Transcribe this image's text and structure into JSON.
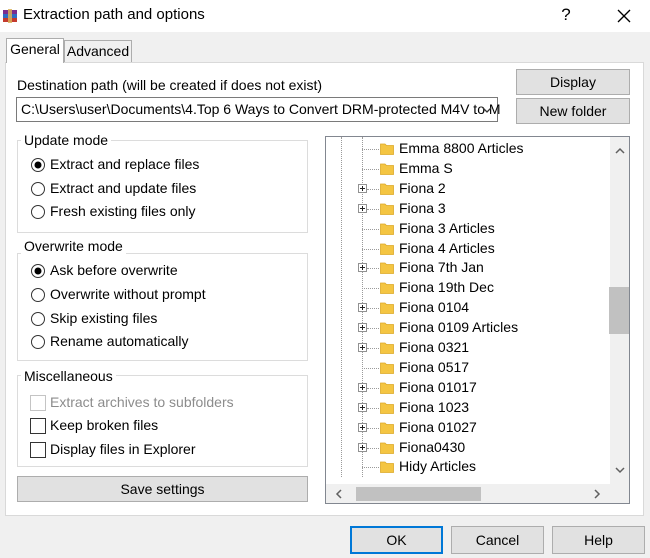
{
  "window": {
    "title": "Extraction path and options",
    "help_label": "?",
    "close_icon": "close-icon",
    "app_icon": "winrar-books-icon"
  },
  "tabs": [
    {
      "label": "General",
      "selected": true
    },
    {
      "label": "Advanced",
      "selected": false
    }
  ],
  "destination": {
    "label": "Destination path (will be created if does not exist)",
    "value": "C:\\Users\\user\\Documents\\4.Top 6 Ways to Convert DRM-protected M4V to M"
  },
  "buttons": {
    "display": "Display",
    "new_folder": "New folder",
    "save_settings": "Save settings",
    "ok": "OK",
    "cancel": "Cancel",
    "help": "Help"
  },
  "update_mode": {
    "label": "Update mode",
    "options": [
      {
        "label": "Extract and replace files",
        "checked": true
      },
      {
        "label": "Extract and update files",
        "checked": false
      },
      {
        "label": "Fresh existing files only",
        "checked": false
      }
    ]
  },
  "overwrite_mode": {
    "label": "Overwrite mode",
    "options": [
      {
        "label": "Ask before overwrite",
        "checked": true
      },
      {
        "label": "Overwrite without prompt",
        "checked": false
      },
      {
        "label": "Skip existing files",
        "checked": false
      },
      {
        "label": "Rename automatically",
        "checked": false
      }
    ]
  },
  "misc": {
    "label": "Miscellaneous",
    "options": [
      {
        "label": "Extract archives to subfolders",
        "checked": false,
        "disabled": true
      },
      {
        "label": "Keep broken files",
        "checked": false,
        "disabled": false
      },
      {
        "label": "Display files in Explorer",
        "checked": false,
        "disabled": false
      }
    ]
  },
  "tree": {
    "items": [
      {
        "label": "Emma 8800 Articles",
        "expandable": false
      },
      {
        "label": "Emma S",
        "expandable": false
      },
      {
        "label": "Fiona 2",
        "expandable": true
      },
      {
        "label": "Fiona 3",
        "expandable": true
      },
      {
        "label": "Fiona 3 Articles",
        "expandable": false
      },
      {
        "label": "Fiona 4 Articles",
        "expandable": false
      },
      {
        "label": "Fiona 7th Jan",
        "expandable": true
      },
      {
        "label": "Fiona 19th Dec",
        "expandable": false
      },
      {
        "label": "Fiona 0104",
        "expandable": true
      },
      {
        "label": "Fiona 0109 Articles",
        "expandable": true
      },
      {
        "label": "Fiona 0321",
        "expandable": true
      },
      {
        "label": "Fiona 0517",
        "expandable": false
      },
      {
        "label": "Fiona 01017",
        "expandable": true
      },
      {
        "label": "Fiona 1023",
        "expandable": true
      },
      {
        "label": "Fiona 01027",
        "expandable": true
      },
      {
        "label": "Fiona0430",
        "expandable": true
      },
      {
        "label": "Hidy Articles",
        "expandable": false
      }
    ]
  },
  "colors": {
    "folder": "#f4c542",
    "folder_dark": "#dca92a",
    "accent": "#0078d7"
  }
}
